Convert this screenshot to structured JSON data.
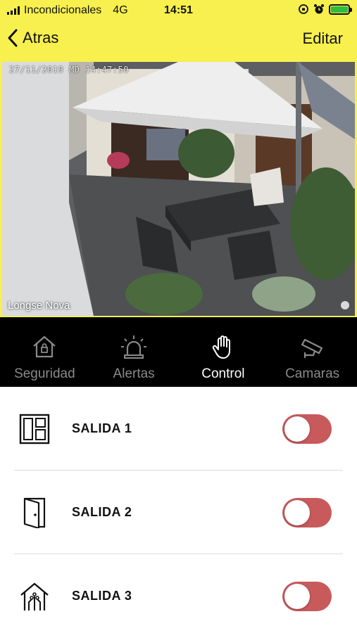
{
  "status_bar": {
    "carrier": "Incondicionales",
    "network": "4G",
    "time": "14:51"
  },
  "nav": {
    "back_label": "Atras",
    "edit_label": "Editar"
  },
  "camera": {
    "timestamp": "27/11/2019 MD 14:47:50",
    "name": "Longse Nova"
  },
  "tabs": [
    {
      "label": "Seguridad",
      "icon": "house-lock-icon",
      "active": false
    },
    {
      "label": "Alertas",
      "icon": "siren-icon",
      "active": false
    },
    {
      "label": "Control",
      "icon": "hand-icon",
      "active": true
    },
    {
      "label": "Camaras",
      "icon": "security-camera-icon",
      "active": false
    }
  ],
  "outputs": [
    {
      "label": "SALIDA 1",
      "icon": "window-panel-icon",
      "on": false
    },
    {
      "label": "SALIDA 2",
      "icon": "door-icon",
      "on": false
    },
    {
      "label": "SALIDA 3",
      "icon": "smart-home-icon",
      "on": false
    }
  ],
  "colors": {
    "header_yellow": "#f7f04e",
    "tab_bar_bg": "#000000",
    "toggle_off_red": "#c85a5c",
    "battery_green": "#2fbd3f"
  }
}
